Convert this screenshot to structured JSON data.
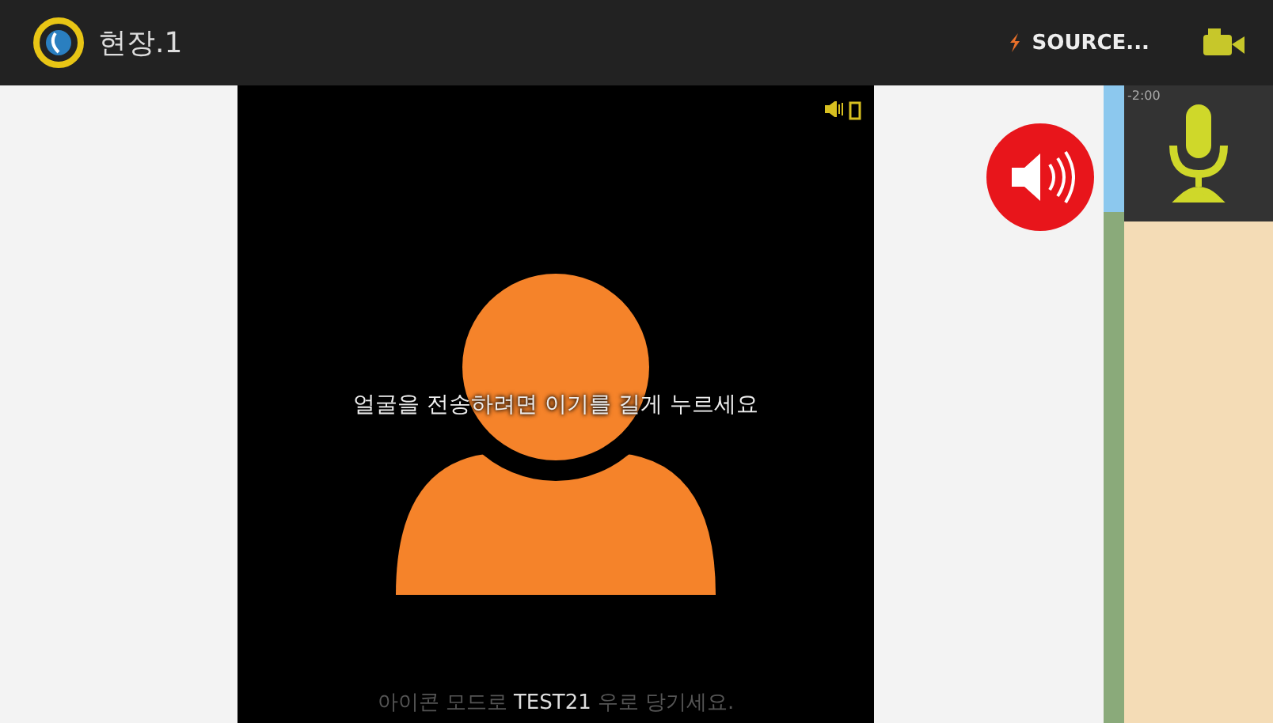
{
  "header": {
    "title": "현장.1",
    "source_label": "SOURCE..."
  },
  "video": {
    "prompt": "얼굴을 전송하려면 이기를 길게 누르세요",
    "hint_start": "아이콘 모드로",
    "caller": "TEST21",
    "hint_end": "우로 당기세요."
  },
  "side": {
    "timer": "-2:00",
    "speaker_on": true
  }
}
